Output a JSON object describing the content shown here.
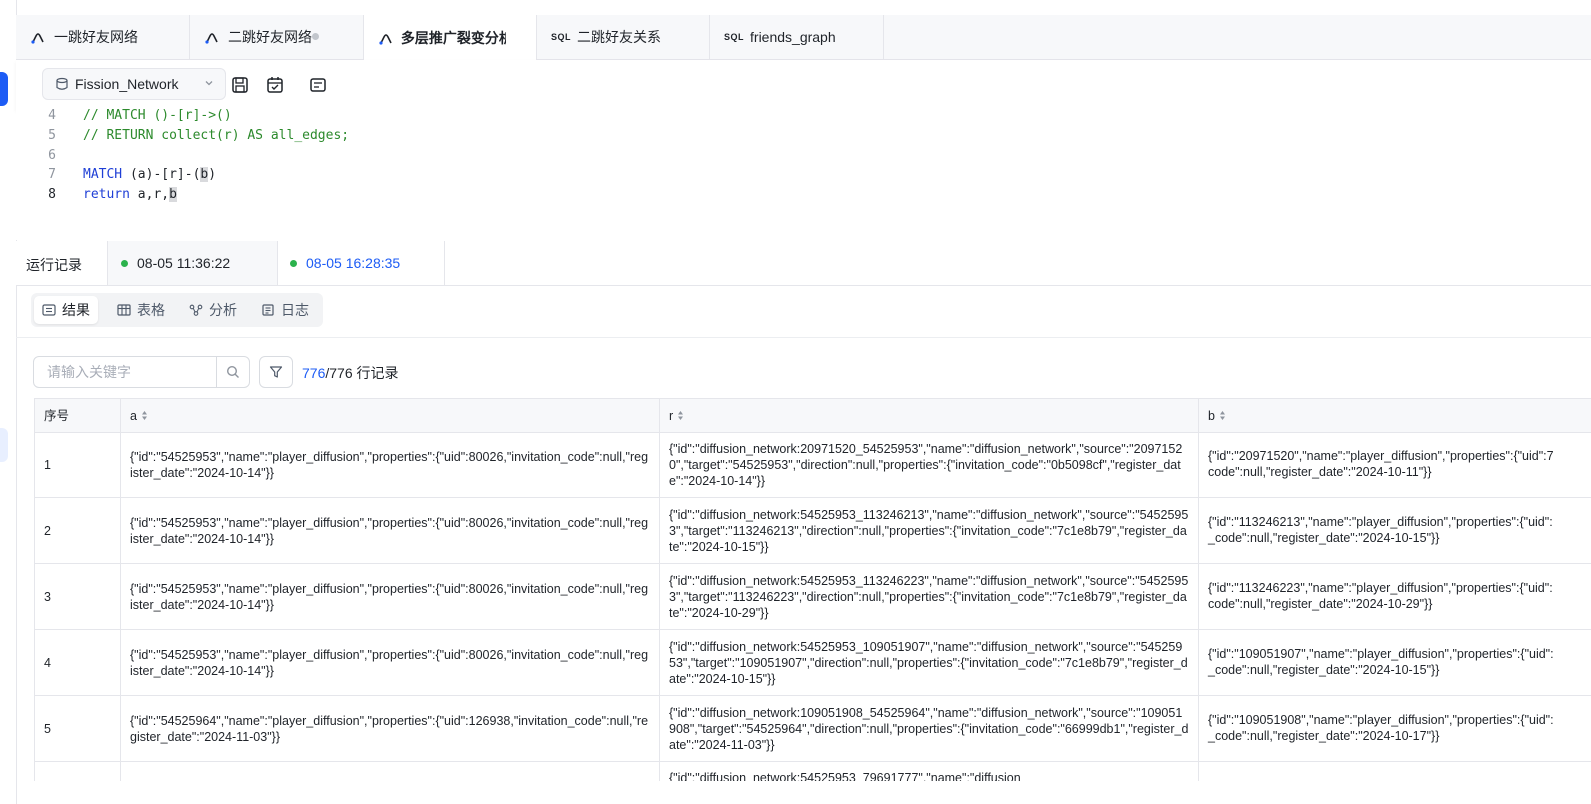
{
  "tabs": [
    {
      "label": "一跳好友网络",
      "icon": "graph-query-icon"
    },
    {
      "label": "二跳好友网络",
      "icon": "graph-query-icon",
      "unsaved": true
    },
    {
      "label": "多层推广裂变分析",
      "icon": "graph-query-icon",
      "active": true
    },
    {
      "label": "二跳好友关系",
      "icon": "sql-icon",
      "prefix": "SQL"
    },
    {
      "label": "friends_graph",
      "icon": "sql-icon",
      "prefix": "SQL"
    }
  ],
  "toolbar": {
    "database": "Fission_Network",
    "buttons": [
      "save-icon",
      "schedule-icon",
      "format-icon"
    ]
  },
  "editor": {
    "lines": [
      {
        "num": "4",
        "text": "// MATCH ()-[r]->()"
      },
      {
        "num": "5",
        "text": "// RETURN collect(r) AS all_edges;"
      },
      {
        "num": "6",
        "text": ""
      },
      {
        "num": "7",
        "kw": "MATCH ",
        "rest_a": "(a)-[r]-(",
        "hl": "b",
        "rest_b": ")"
      },
      {
        "num": "8",
        "kw": "return ",
        "rest_a": "a,r,",
        "hl": "b",
        "rest_b": ""
      }
    ]
  },
  "run": {
    "label": "运行记录",
    "records": [
      "08-05 11:36:22",
      "08-05 16:28:35"
    ]
  },
  "subtabs": [
    "结果",
    "表格",
    "分析",
    "日志"
  ],
  "search": {
    "placeholder": "请输入关键字"
  },
  "count": {
    "shown": "776",
    "total": "/776 行记录"
  },
  "table": {
    "columns": [
      "序号",
      "a",
      "r",
      "b"
    ],
    "rows": [
      {
        "idx": "1",
        "a": "{\"id\":\"54525953\",\"name\":\"player_diffusion\",\"properties\":{\"uid\":80026,\"invitation_code\":null,\"register_date\":\"2024-10-14\"}}",
        "r": "{\"id\":\"diffusion_network:20971520_54525953\",\"name\":\"diffusion_network\",\"source\":\"20971520\",\"target\":\"54525953\",\"direction\":null,\"properties\":{\"invitation_code\":\"0b5098cf\",\"register_date\":\"2024-10-14\"}}",
        "b": "{\"id\":\"20971520\",\"name\":\"player_diffusion\",\"properties\":{\"uid\":7"
      },
      {
        "idx": "2",
        "a": "{\"id\":\"54525953\",\"name\":\"player_diffusion\",\"properties\":{\"uid\":80026,\"invitation_code\":null,\"register_date\":\"2024-10-14\"}}",
        "r": "{\"id\":\"diffusion_network:54525953_113246213\",\"name\":\"diffusion_network\",\"source\":\"54525953\",\"target\":\"113246213\",\"direction\":null,\"properties\":{\"invitation_code\":\"7c1e8b79\",\"register_date\":\"2024-10-15\"}}",
        "b": "{\"id\":\"113246213\",\"name\":\"player_diffusion\",\"properties\":{\"uid\":"
      },
      {
        "idx": "3",
        "a": "{\"id\":\"54525953\",\"name\":\"player_diffusion\",\"properties\":{\"uid\":80026,\"invitation_code\":null,\"register_date\":\"2024-10-14\"}}",
        "r": "{\"id\":\"diffusion_network:54525953_113246223\",\"name\":\"diffusion_network\",\"source\":\"54525953\",\"target\":\"113246223\",\"direction\":null,\"properties\":{\"invitation_code\":\"7c1e8b79\",\"register_date\":\"2024-10-29\"}}",
        "b": "{\"id\":\"113246223\",\"name\":\"player_diffusion\",\"properties\":{\"uid\":"
      },
      {
        "idx": "4",
        "a": "{\"id\":\"54525953\",\"name\":\"player_diffusion\",\"properties\":{\"uid\":80026,\"invitation_code\":null,\"register_date\":\"2024-10-14\"}}",
        "r": "{\"id\":\"diffusion_network:54525953_109051907\",\"name\":\"diffusion_network\",\"source\":\"54525953\",\"target\":\"109051907\",\"direction\":null,\"properties\":{\"invitation_code\":\"7c1e8b79\",\"register_date\":\"2024-10-15\"}}",
        "b": "{\"id\":\"109051907\",\"name\":\"player_diffusion\",\"properties\":{\"uid\":"
      },
      {
        "idx": "5",
        "a": "{\"id\":\"54525964\",\"name\":\"player_diffusion\",\"properties\":{\"uid\":126938,\"invitation_code\":null,\"register_date\":\"2024-11-03\"}}",
        "r": "{\"id\":\"diffusion_network:109051908_54525964\",\"name\":\"diffusion_network\",\"source\":\"109051908\",\"target\":\"54525964\",\"direction\":null,\"properties\":{\"invitation_code\":\"66999db1\",\"register_date\":\"2024-11-03\"}}",
        "b": "{\"id\":\"109051908\",\"name\":\"player_diffusion\",\"properties\":{\"uid\":"
      },
      {
        "idx": "",
        "a": "",
        "r": "{\"id\":\"diffusion_network:54525953_79691777\",\"name\":\"diffusion",
        "b": ""
      }
    ],
    "b_tails": [
      "code\":null,\"register_date\":\"2024-10-11\"}}",
      "_code\":null,\"register_date\":\"2024-10-15\"}}",
      "code\":null,\"register_date\":\"2024-10-29\"}}",
      "_code\":null,\"register_date\":\"2024-10-15\"}}",
      "_code\":null,\"register_date\":\"2024-10-17\"}}",
      ""
    ]
  },
  "colors": {
    "accent": "#1d5cf5",
    "success": "#2bb24c",
    "comment": "#2c8a2c",
    "keyword": "#1f3fd6"
  }
}
